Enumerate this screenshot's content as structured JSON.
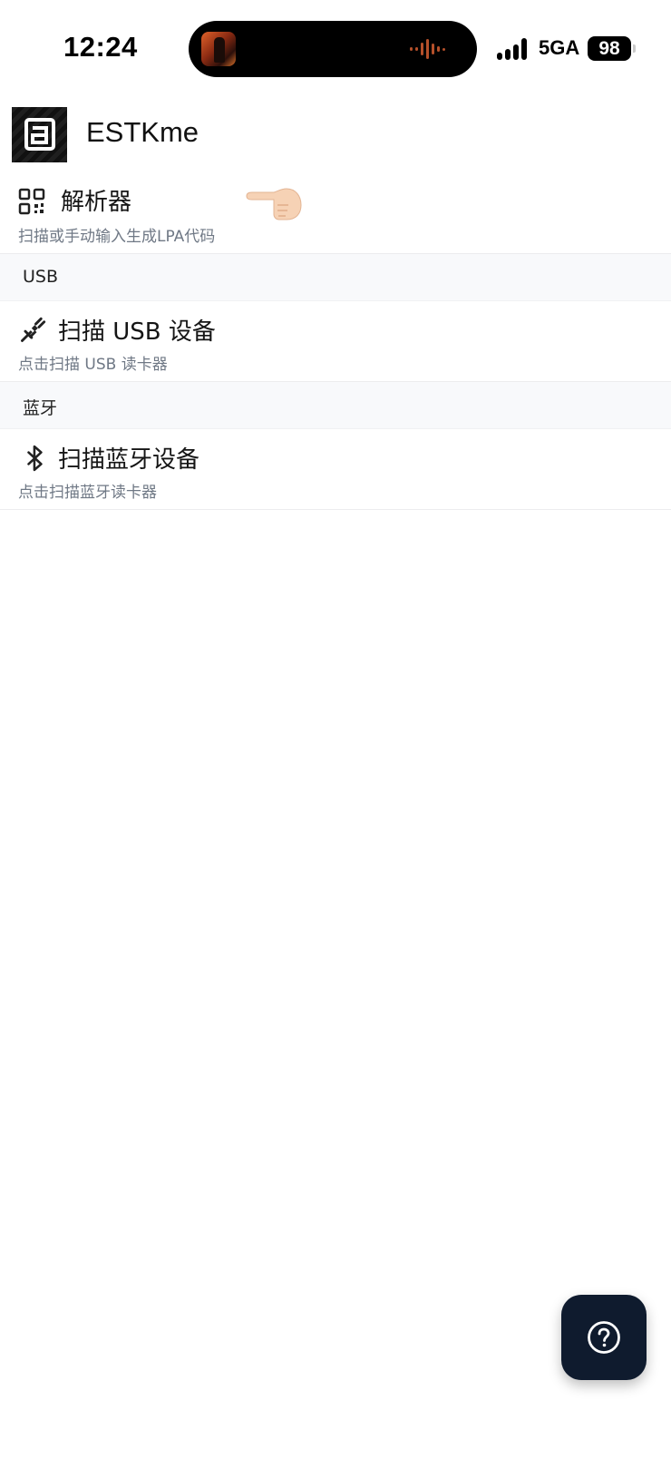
{
  "status_bar": {
    "time": "12:24",
    "network": "5GA",
    "battery": "98"
  },
  "header": {
    "title": "ESTKme",
    "logo_icon": "estkme-logo-icon"
  },
  "items": {
    "parser": {
      "title": "解析器",
      "subtitle": "扫描或手动输入生成LPA代码",
      "icon": "qr-code-icon"
    },
    "usb_section": "USB",
    "usb_scan": {
      "title": "扫描 USB 设备",
      "subtitle": "点击扫描 USB 读卡器",
      "icon": "usb-plug-icon"
    },
    "bt_section": "蓝牙",
    "bt_scan": {
      "title": "扫描蓝牙设备",
      "subtitle": "点击扫描蓝牙读卡器",
      "icon": "bluetooth-icon"
    }
  },
  "help": {
    "icon": "question-circle-icon"
  },
  "colors": {
    "fab_background": "#0f1b2e",
    "subtitle_text": "#6f7885",
    "section_background": "#f8f9fb"
  }
}
